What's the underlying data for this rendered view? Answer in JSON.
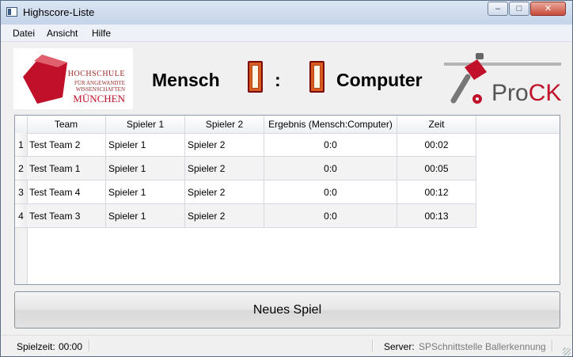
{
  "window": {
    "title": "Highscore-Liste",
    "min_glyph": "‒",
    "max_glyph": "□",
    "close_glyph": "✕"
  },
  "menu": {
    "items": [
      "Datei",
      "Ansicht",
      "Hilfe"
    ]
  },
  "header": {
    "logo_hm": {
      "line1": "HOCHSCHULE",
      "line2": "FÜR ANGEWANDTE",
      "line3": "WISSENSCHAFTEN",
      "line4": "MÜNCHEN"
    },
    "player_human": "Mensch",
    "separator": ":",
    "player_computer": "Computer",
    "logo_prock": {
      "pro": "Pro",
      "ck": "CK",
      "pro_color": "#555555",
      "ck_color": "#c0102a"
    }
  },
  "table": {
    "columns": [
      "Team",
      "Spieler 1",
      "Spieler 2",
      "Ergebnis (Mensch:Computer)",
      "Zeit"
    ],
    "rows": [
      {
        "num": "1",
        "team": "Test Team 2",
        "p1": "Spieler 1",
        "p2": "Spieler 2",
        "result": "0:0",
        "time": "00:02"
      },
      {
        "num": "2",
        "team": "Test Team 1",
        "p1": "Spieler 1",
        "p2": "Spieler 2",
        "result": "0:0",
        "time": "00:05"
      },
      {
        "num": "3",
        "team": "Test Team 4",
        "p1": "Spieler 1",
        "p2": "Spieler 2",
        "result": "0:0",
        "time": "00:12"
      },
      {
        "num": "4",
        "team": "Test Team 3",
        "p1": "Spieler 1",
        "p2": "Spieler 2",
        "result": "0:0",
        "time": "00:13"
      }
    ]
  },
  "new_game_label": "Neues Spiel",
  "status": {
    "playtime_label": "Spielzeit:",
    "playtime_value": "00:00",
    "server_label": "Server:",
    "server_item1": "SPSchnittstelle",
    "server_item2": "Ballerkennung"
  },
  "colors": {
    "accent_red": "#c0102a",
    "score_box": "#d95d1e",
    "score_border": "#7a0a0a"
  }
}
